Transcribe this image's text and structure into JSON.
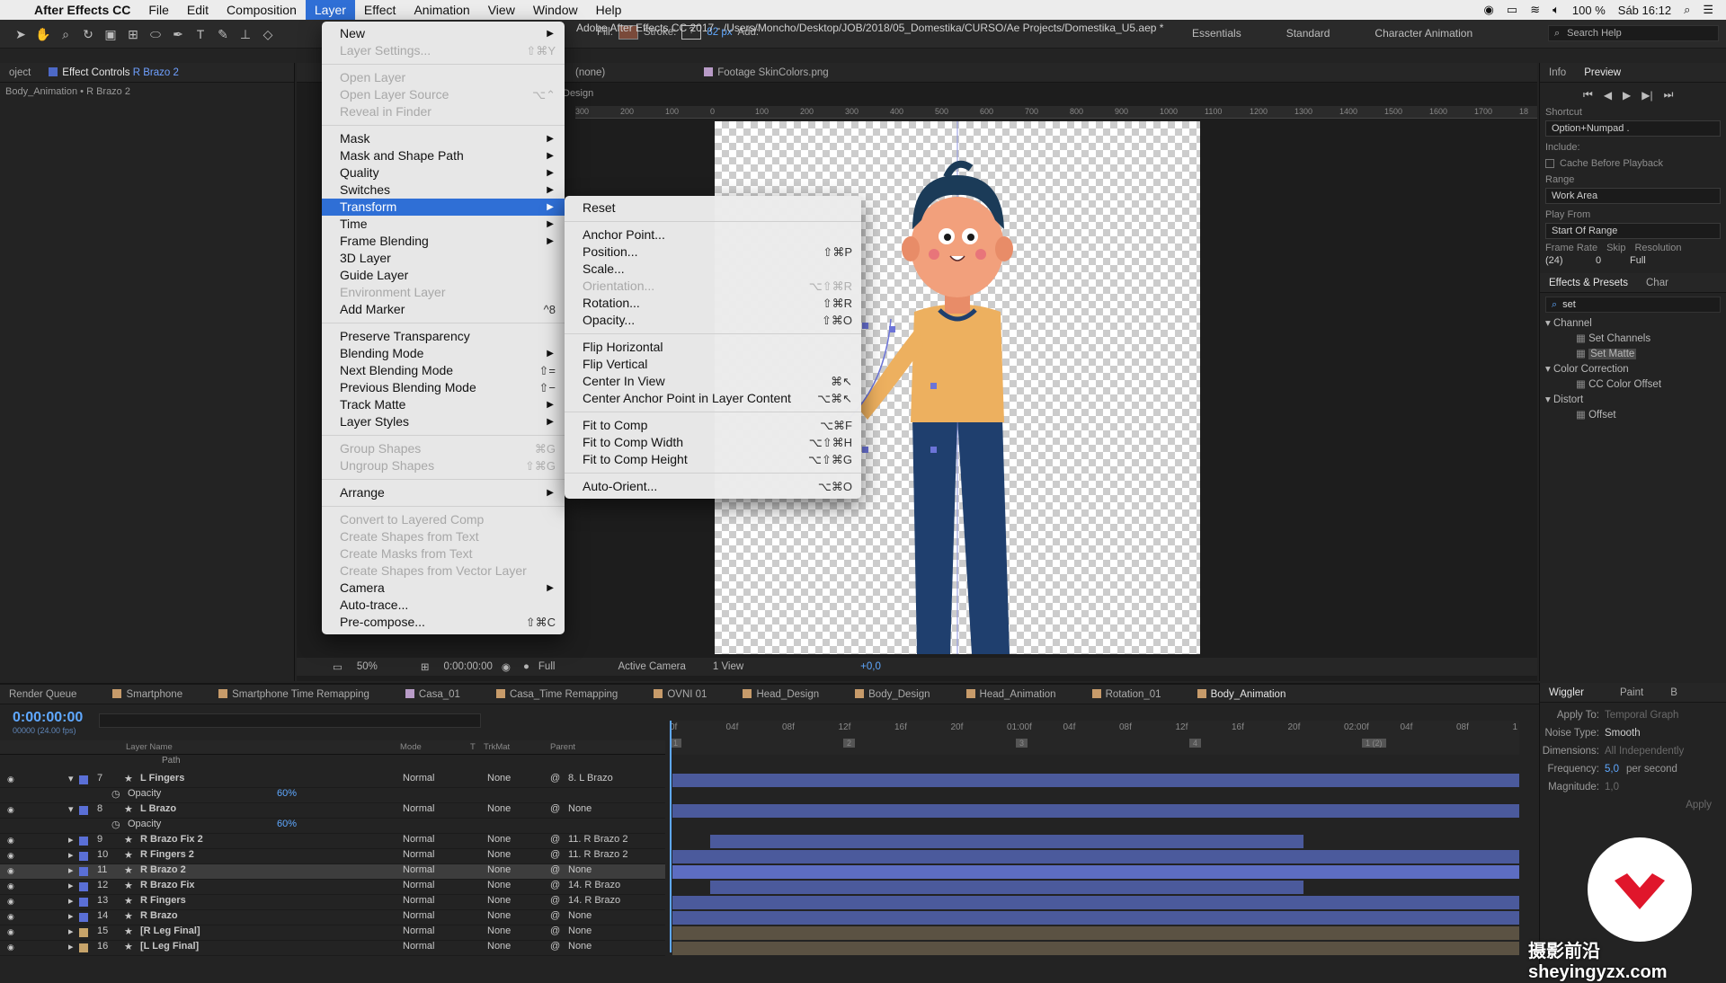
{
  "menubar": {
    "app": "After Effects CC",
    "items": [
      "File",
      "Edit",
      "Composition",
      "Layer",
      "Effect",
      "Animation",
      "View",
      "Window",
      "Help"
    ],
    "active_index": 3,
    "battery": "100 %",
    "clock": "Sáb 16:12"
  },
  "toolbar": {
    "fill_label": "Fill:",
    "stroke_label": "Stroke:",
    "stroke_width": "82 px",
    "add_label": "Add:",
    "doc_title": "Adobe After Effects CC 2017 - /Users/Moncho/Desktop/JOB/2018/05_Domestika/CURSO/Ae Projects/Domestika_U5.aep *",
    "workspaces": [
      "Essentials",
      "Standard",
      "Character Animation"
    ],
    "search_help": "Search Help"
  },
  "left_panel": {
    "tab_project": "oject",
    "tab_effect_controls": "Effect Controls",
    "effect_layer": "R Brazo 2",
    "breadcrumb": "Body_Animation • R Brazo 2"
  },
  "viewer": {
    "tab_layer_none": "(none)",
    "tab_footage": "Footage SkinColors.png",
    "comp_label": "Design",
    "ruler_labels": [
      "300",
      "200",
      "100",
      "0",
      "100",
      "200",
      "300",
      "400",
      "500",
      "600",
      "700",
      "800",
      "900",
      "1000",
      "1100",
      "1200",
      "1300",
      "1400",
      "1500",
      "1600",
      "1700",
      "18"
    ],
    "zoom": "50%",
    "timecode": "0:00:00:00",
    "resolution": "Full",
    "camera": "Active Camera",
    "views": "1 View",
    "exposure": "+0,0"
  },
  "layer_menu": {
    "items": [
      {
        "label": "New",
        "arrow": true
      },
      {
        "label": "Layer Settings...",
        "shortcut": "⇧⌘Y",
        "disabled": true
      },
      {
        "sep": true
      },
      {
        "label": "Open Layer",
        "disabled": true
      },
      {
        "label": "Open Layer Source",
        "shortcut": "⌥⌃",
        "disabled": true
      },
      {
        "label": "Reveal in Finder",
        "disabled": true
      },
      {
        "sep": true
      },
      {
        "label": "Mask",
        "arrow": true
      },
      {
        "label": "Mask and Shape Path",
        "arrow": true
      },
      {
        "label": "Quality",
        "arrow": true
      },
      {
        "label": "Switches",
        "arrow": true
      },
      {
        "label": "Transform",
        "arrow": true,
        "highlight": true
      },
      {
        "label": "Time",
        "arrow": true
      },
      {
        "label": "Frame Blending",
        "arrow": true
      },
      {
        "label": "3D Layer"
      },
      {
        "label": "Guide Layer"
      },
      {
        "label": "Environment Layer",
        "disabled": true
      },
      {
        "label": "Add Marker",
        "shortcut": "^8"
      },
      {
        "sep": true
      },
      {
        "label": "Preserve Transparency"
      },
      {
        "label": "Blending Mode",
        "arrow": true
      },
      {
        "label": "Next Blending Mode",
        "shortcut": "⇧="
      },
      {
        "label": "Previous Blending Mode",
        "shortcut": "⇧−"
      },
      {
        "label": "Track Matte",
        "arrow": true
      },
      {
        "label": "Layer Styles",
        "arrow": true
      },
      {
        "sep": true
      },
      {
        "label": "Group Shapes",
        "shortcut": "⌘G",
        "disabled": true
      },
      {
        "label": "Ungroup Shapes",
        "shortcut": "⇧⌘G",
        "disabled": true
      },
      {
        "sep": true
      },
      {
        "label": "Arrange",
        "arrow": true
      },
      {
        "sep": true
      },
      {
        "label": "Convert to Layered Comp",
        "disabled": true
      },
      {
        "label": "Create Shapes from Text",
        "disabled": true
      },
      {
        "label": "Create Masks from Text",
        "disabled": true
      },
      {
        "label": "Create Shapes from Vector Layer",
        "disabled": true
      },
      {
        "label": "Camera",
        "arrow": true
      },
      {
        "label": "Auto-trace..."
      },
      {
        "label": "Pre-compose...",
        "shortcut": "⇧⌘C"
      }
    ]
  },
  "transform_menu": {
    "items": [
      {
        "label": "Reset"
      },
      {
        "sep": true
      },
      {
        "label": "Anchor Point..."
      },
      {
        "label": "Position...",
        "shortcut": "⇧⌘P"
      },
      {
        "label": "Scale..."
      },
      {
        "label": "Orientation...",
        "shortcut": "⌥⇧⌘R",
        "disabled": true
      },
      {
        "label": "Rotation...",
        "shortcut": "⇧⌘R"
      },
      {
        "label": "Opacity...",
        "shortcut": "⇧⌘O"
      },
      {
        "sep": true
      },
      {
        "label": "Flip Horizontal"
      },
      {
        "label": "Flip Vertical"
      },
      {
        "label": "Center In View",
        "shortcut": "⌘↖"
      },
      {
        "label": "Center Anchor Point in Layer Content",
        "shortcut": "⌥⌘↖"
      },
      {
        "sep": true
      },
      {
        "label": "Fit to Comp",
        "shortcut": "⌥⌘F"
      },
      {
        "label": "Fit to Comp Width",
        "shortcut": "⌥⇧⌘H"
      },
      {
        "label": "Fit to Comp Height",
        "shortcut": "⌥⇧⌘G"
      },
      {
        "sep": true
      },
      {
        "label": "Auto-Orient...",
        "shortcut": "⌥⌘O"
      }
    ]
  },
  "right_panel": {
    "tab_info": "Info",
    "tab_preview": "Preview",
    "shortcut_label": "Shortcut",
    "shortcut_value": "Option+Numpad .",
    "include_label": "Include:",
    "cache_label": "Cache Before Playback",
    "range_label": "Range",
    "range_value": "Work Area",
    "play_from_label": "Play From",
    "play_from_value": "Start Of Range",
    "frame_rate_label": "Frame Rate",
    "skip_label": "Skip",
    "resolution_label": "Resolution",
    "frame_rate_value": "(24)",
    "skip_value": "0",
    "resolution_value": "Full",
    "tab_effects": "Effects & Presets",
    "tab_char": "Char",
    "effects_search": "set",
    "tree": [
      {
        "cat": "Channel",
        "items": [
          "Set Channels",
          "Set Matte"
        ]
      },
      {
        "cat": "Color Correction",
        "items": [
          "CC Color Offset"
        ]
      },
      {
        "cat": "Distort",
        "items": [
          "Offset"
        ]
      }
    ]
  },
  "timeline": {
    "tabs": [
      "Render Queue",
      "Smartphone",
      "Smartphone Time Remapping",
      "Casa_01",
      "Casa_Time Remapping",
      "OVNI 01",
      "Head_Design",
      "Body_Design",
      "Head_Animation",
      "Rotation_01",
      "Body_Animation"
    ],
    "active_tab": "Body_Animation",
    "timecode": "0:00:00:00",
    "fps": "00000 (24.00 fps)",
    "headers": {
      "name": "Layer Name",
      "mode": "Mode",
      "t": "T",
      "trkmat": "TrkMat",
      "parent": "Parent"
    },
    "ruler": [
      "0f",
      "04f",
      "08f",
      "12f",
      "16f",
      "20f",
      "01:00f",
      "04f",
      "08f",
      "12f",
      "16f",
      "20f",
      "02:00f",
      "04f",
      "08f",
      "1"
    ],
    "markers": [
      "1",
      "2",
      "3",
      "4",
      "1 (2)"
    ],
    "path_label": "Path",
    "layers": [
      {
        "num": "7",
        "name": "L Fingers",
        "mode": "Normal",
        "trk": "None",
        "parent": "8. L Brazo",
        "expanded": true,
        "prop": "Opacity",
        "prop_val": "60%"
      },
      {
        "num": "8",
        "name": "L Brazo",
        "mode": "Normal",
        "trk": "None",
        "parent": "None",
        "expanded": true,
        "prop": "Opacity",
        "prop_val": "60%"
      },
      {
        "num": "9",
        "name": "R Brazo Fix 2",
        "mode": "Normal",
        "trk": "None",
        "parent": "11. R Brazo 2"
      },
      {
        "num": "10",
        "name": "R Fingers 2",
        "mode": "Normal",
        "trk": "None",
        "parent": "11. R Brazo 2"
      },
      {
        "num": "11",
        "name": "R Brazo 2",
        "mode": "Normal",
        "trk": "None",
        "parent": "None",
        "selected": true
      },
      {
        "num": "12",
        "name": "R Brazo Fix",
        "mode": "Normal",
        "trk": "None",
        "parent": "14. R Brazo"
      },
      {
        "num": "13",
        "name": "R Fingers",
        "mode": "Normal",
        "trk": "None",
        "parent": "14. R Brazo"
      },
      {
        "num": "14",
        "name": "R Brazo",
        "mode": "Normal",
        "trk": "None",
        "parent": "None"
      },
      {
        "num": "15",
        "name": "[R Leg Final]",
        "mode": "Normal",
        "trk": "None",
        "parent": "None"
      },
      {
        "num": "16",
        "name": "[L Leg Final]",
        "mode": "Normal",
        "trk": "None",
        "parent": "None"
      }
    ]
  },
  "wiggler": {
    "tab": "Wiggler",
    "tab2": "Paint",
    "tab3": "B",
    "apply_to_label": "Apply To:",
    "apply_to_value": "Temporal Graph",
    "noise_label": "Noise Type:",
    "noise_value": "Smooth",
    "dims_label": "Dimensions:",
    "dims_value": "All Independently",
    "freq_label": "Frequency:",
    "freq_value": "5,0",
    "freq_unit": "per second",
    "mag_label": "Magnitude:",
    "mag_value": "1,0",
    "apply_button": "Apply"
  },
  "watermark": "摄影前沿sheyingyzx.com"
}
